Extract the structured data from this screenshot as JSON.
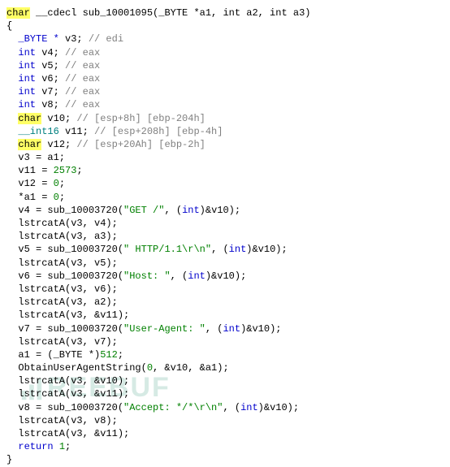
{
  "code": {
    "sig_kw1": "char",
    "sig_rest": " __cdecl sub_10001095(_BYTE *a1, int a2, int a3)",
    "open_brace": "{",
    "decls": [
      {
        "pre": "  ",
        "type": "_BYTE *",
        "name": "v3;",
        "comment": " // edi"
      },
      {
        "pre": "  ",
        "type": "int ",
        "name": "v4;",
        "comment": " // eax"
      },
      {
        "pre": "  ",
        "type": "int ",
        "name": "v5;",
        "comment": " // eax"
      },
      {
        "pre": "  ",
        "type": "int ",
        "name": "v6;",
        "comment": " // eax"
      },
      {
        "pre": "  ",
        "type": "int ",
        "name": "v7;",
        "comment": " // eax"
      },
      {
        "pre": "  ",
        "type": "int ",
        "name": "v8;",
        "comment": " // eax"
      }
    ],
    "hl_decl1_kw": "char",
    "hl_decl1_rest": " v10;",
    "hl_decl1_comment": " // [esp+8h] [ebp-204h]",
    "decl_mid_type": "__int16 ",
    "decl_mid_name": "v11;",
    "decl_mid_comment": " // [esp+208h] [ebp-4h]",
    "hl_decl2_kw": "char",
    "hl_decl2_rest": " v12;",
    "hl_decl2_comment": " // [esp+20Ah] [ebp-2h]",
    "body": [
      {
        "t": "assign",
        "lhs": "v3 = a1;",
        "rhs": ""
      },
      {
        "t": "assignnum",
        "lhs": "v11 = ",
        "num": "2573",
        "tail": ";"
      },
      {
        "t": "assignnum",
        "lhs": "v12 = ",
        "num": "0",
        "tail": ";"
      },
      {
        "t": "assignnum",
        "lhs": "*a1 = ",
        "num": "0",
        "tail": ";"
      },
      {
        "t": "call",
        "text1": "v4 = sub_10003720(",
        "str": "\"GET /\"",
        "text2": ", (",
        "kw": "int",
        "text3": ")&v10);"
      },
      {
        "t": "plain",
        "text": "lstrcatA(v3, v4);"
      },
      {
        "t": "plain",
        "text": "lstrcatA(v3, a3);"
      },
      {
        "t": "call",
        "text1": "v5 = sub_10003720(",
        "str": "\" HTTP/1.1\\r\\n\"",
        "text2": ", (",
        "kw": "int",
        "text3": ")&v10);"
      },
      {
        "t": "plain",
        "text": "lstrcatA(v3, v5);"
      },
      {
        "t": "call",
        "text1": "v6 = sub_10003720(",
        "str": "\"Host: \"",
        "text2": ", (",
        "kw": "int",
        "text3": ")&v10);"
      },
      {
        "t": "plain",
        "text": "lstrcatA(v3, v6);"
      },
      {
        "t": "plain",
        "text": "lstrcatA(v3, a2);"
      },
      {
        "t": "plain",
        "text": "lstrcatA(v3, &v11);"
      },
      {
        "t": "call",
        "text1": "v7 = sub_10003720(",
        "str": "\"User-Agent: \"",
        "text2": ", (",
        "kw": "int",
        "text3": ")&v10);"
      },
      {
        "t": "plain",
        "text": "lstrcatA(v3, v7);"
      },
      {
        "t": "castnum",
        "text1": "a1 = (_BYTE *)",
        "num": "512",
        "text2": ";"
      },
      {
        "t": "obt",
        "text1": "ObtainUserAgentString(",
        "num": "0",
        "text2": ", &v10, &a1);"
      },
      {
        "t": "plain",
        "text": "lstrcatA(v3, &v10);"
      },
      {
        "t": "plain",
        "text": "lstrcatA(v3, &v11);"
      },
      {
        "t": "call",
        "text1": "v8 = sub_10003720(",
        "str": "\"Accept: */*\\r\\n\"",
        "text2": ", (",
        "kw": "int",
        "text3": ")&v10);"
      },
      {
        "t": "plain",
        "text": "lstrcatA(v3, v8);"
      },
      {
        "t": "plain",
        "text": "lstrcatA(v3, &v11);"
      },
      {
        "t": "retnum",
        "kw": "return",
        "sp": " ",
        "num": "1",
        "tail": ";"
      }
    ],
    "close_brace": "}"
  },
  "watermark": "REEBUF"
}
